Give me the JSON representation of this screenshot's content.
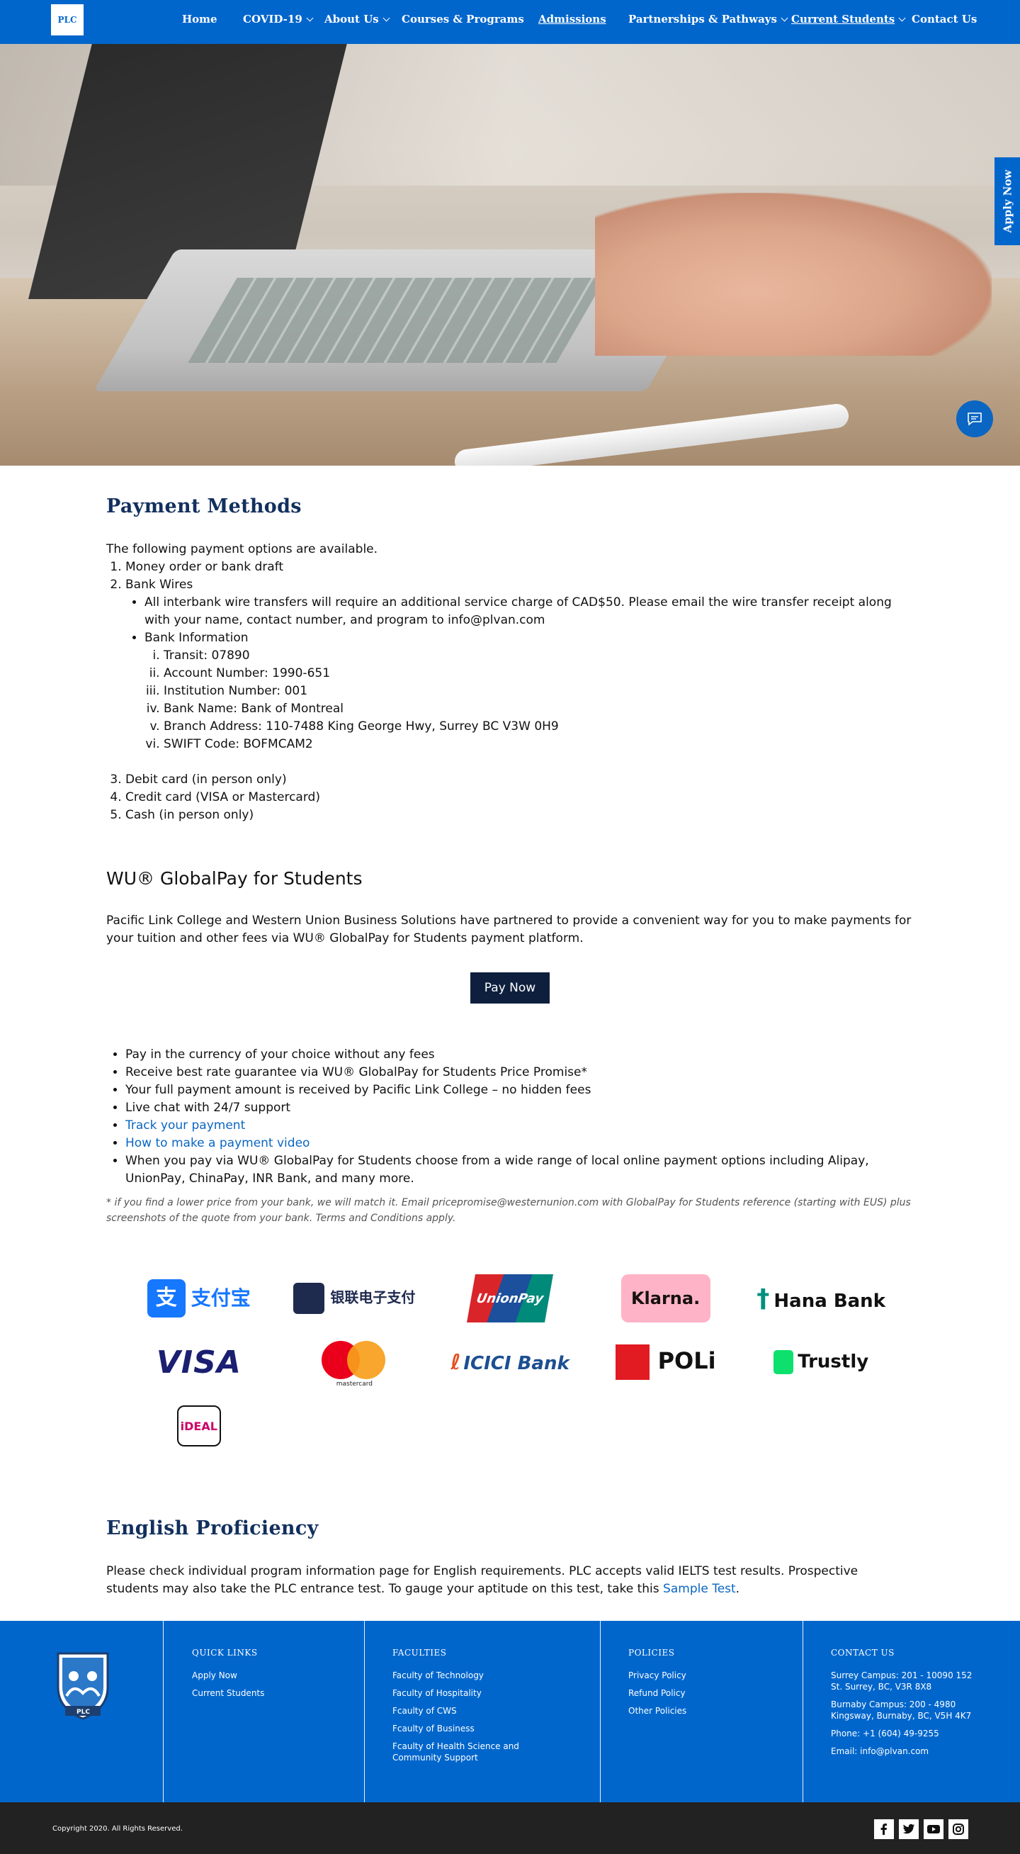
{
  "nav": {
    "logo": "PLC",
    "items": [
      {
        "label": "Home"
      },
      {
        "label": "COVID-19"
      },
      {
        "label": "About Us"
      },
      {
        "label": "Courses & Programs"
      },
      {
        "label": "Admissions"
      },
      {
        "label": "Partnerships & Pathways"
      },
      {
        "label": "Current Students"
      },
      {
        "label": "Contact Us"
      }
    ]
  },
  "apply_tab": "Apply Now",
  "payment": {
    "title": "Payment  Methods",
    "intro": "The following payment options are available.",
    "options": [
      "Money order or bank draft",
      "Bank Wires",
      "Debit card (in person only)",
      "Credit card (VISA or Mastercard)",
      "Cash (in person only)"
    ],
    "wire_note": "All interbank wire transfers will require an additional service charge of CAD$50. Please email the wire transfer receipt along with your name, contact number, and program to info@plvan.com",
    "bank_info_label": "Bank Information",
    "bank_info": [
      "Transit: 07890",
      "Account Number: 1990-651",
      "Institution Number: 001",
      "Bank Name: Bank of Montreal",
      "Branch Address: 110-7488 King George Hwy, Surrey BC  V3W 0H9",
      "SWIFT Code: BOFMCAM2"
    ]
  },
  "globalpay": {
    "title": "WU® GlobalPay for Students",
    "intro": "Pacific Link College and Western Union Business Solutions have partnered to provide a convenient way for you to make payments for your tuition and other fees via WU® GlobalPay for Students payment platform.",
    "pay_button": "Pay Now",
    "features": [
      "Pay in the currency of your choice without any fees",
      "Receive best rate guarantee via WU® GlobalPay for Students Price Promise*",
      "Your full payment amount is received by Pacific Link College – no hidden fees",
      "Live chat with 24/7 support"
    ],
    "link_track": "Track your payment",
    "link_video": "How to make a payment video",
    "local_options": "When you pay via WU® GlobalPay for Students choose from a wide range of local online payment options including Alipay, UnionPay, ChinaPay, INR Bank, and many more.",
    "note": "* if you find a lower price from your bank, we will match it. Email pricepromise@westernunion.com with GlobalPay for Students reference (starting with EUS) plus screenshots of the quote from your bank. Terms and Conditions apply."
  },
  "logos": {
    "alipay": "支付宝",
    "chinapay": "银联电子支付",
    "unionpay": "UnionPay",
    "klarna": "Klarna.",
    "hana": "Hana Bank",
    "visa": "VISA",
    "mastercard": "mastercard",
    "icici": "ICICI Bank",
    "poli": "POLi",
    "trustly": "Trustly",
    "ideal": "iDEAL"
  },
  "english": {
    "title": "English Proficiency",
    "text_before": "Please check individual program information page for English requirements. PLC accepts valid IELTS test results. Prospective students may also take the PLC entrance test. To gauge your aptitude on this test, take this ",
    "link": "Sample Test",
    "text_after": "."
  },
  "footer": {
    "quick_links": {
      "title": "QUICK LINKS",
      "items": [
        "Apply Now",
        "Current Students"
      ]
    },
    "faculties": {
      "title": "FACULTIES",
      "items": [
        "Faculty of Technology",
        "Faculty of  Hospitality",
        "Fcaulty of CWS",
        "Fcaulty of Business",
        "Fcaulty of Health Science and Community Support"
      ]
    },
    "policies": {
      "title": "POLICIES",
      "items": [
        "Privacy Policy",
        "Refund Policy",
        "Other Policies"
      ]
    },
    "contact": {
      "title": "CONTACT US",
      "surrey": "Surrey Campus: 201 - 10090 152 St. Surrey, BC, V3R 8X8",
      "burnaby": "Burnaby Campus: 200 - 4980 Kingsway, Burnaby, BC, V5H 4K7",
      "phone": "Phone: +1 (604) 49-9255",
      "email": "Email: info@plvan.com"
    },
    "crest_text": "PLC",
    "copyright": "Copyright 2020. All Rights Reserved."
  },
  "colors": {
    "brand": "#0066cc",
    "heading": "#12305e",
    "button": "#0d1f3d",
    "footer_bottom": "#222222"
  }
}
